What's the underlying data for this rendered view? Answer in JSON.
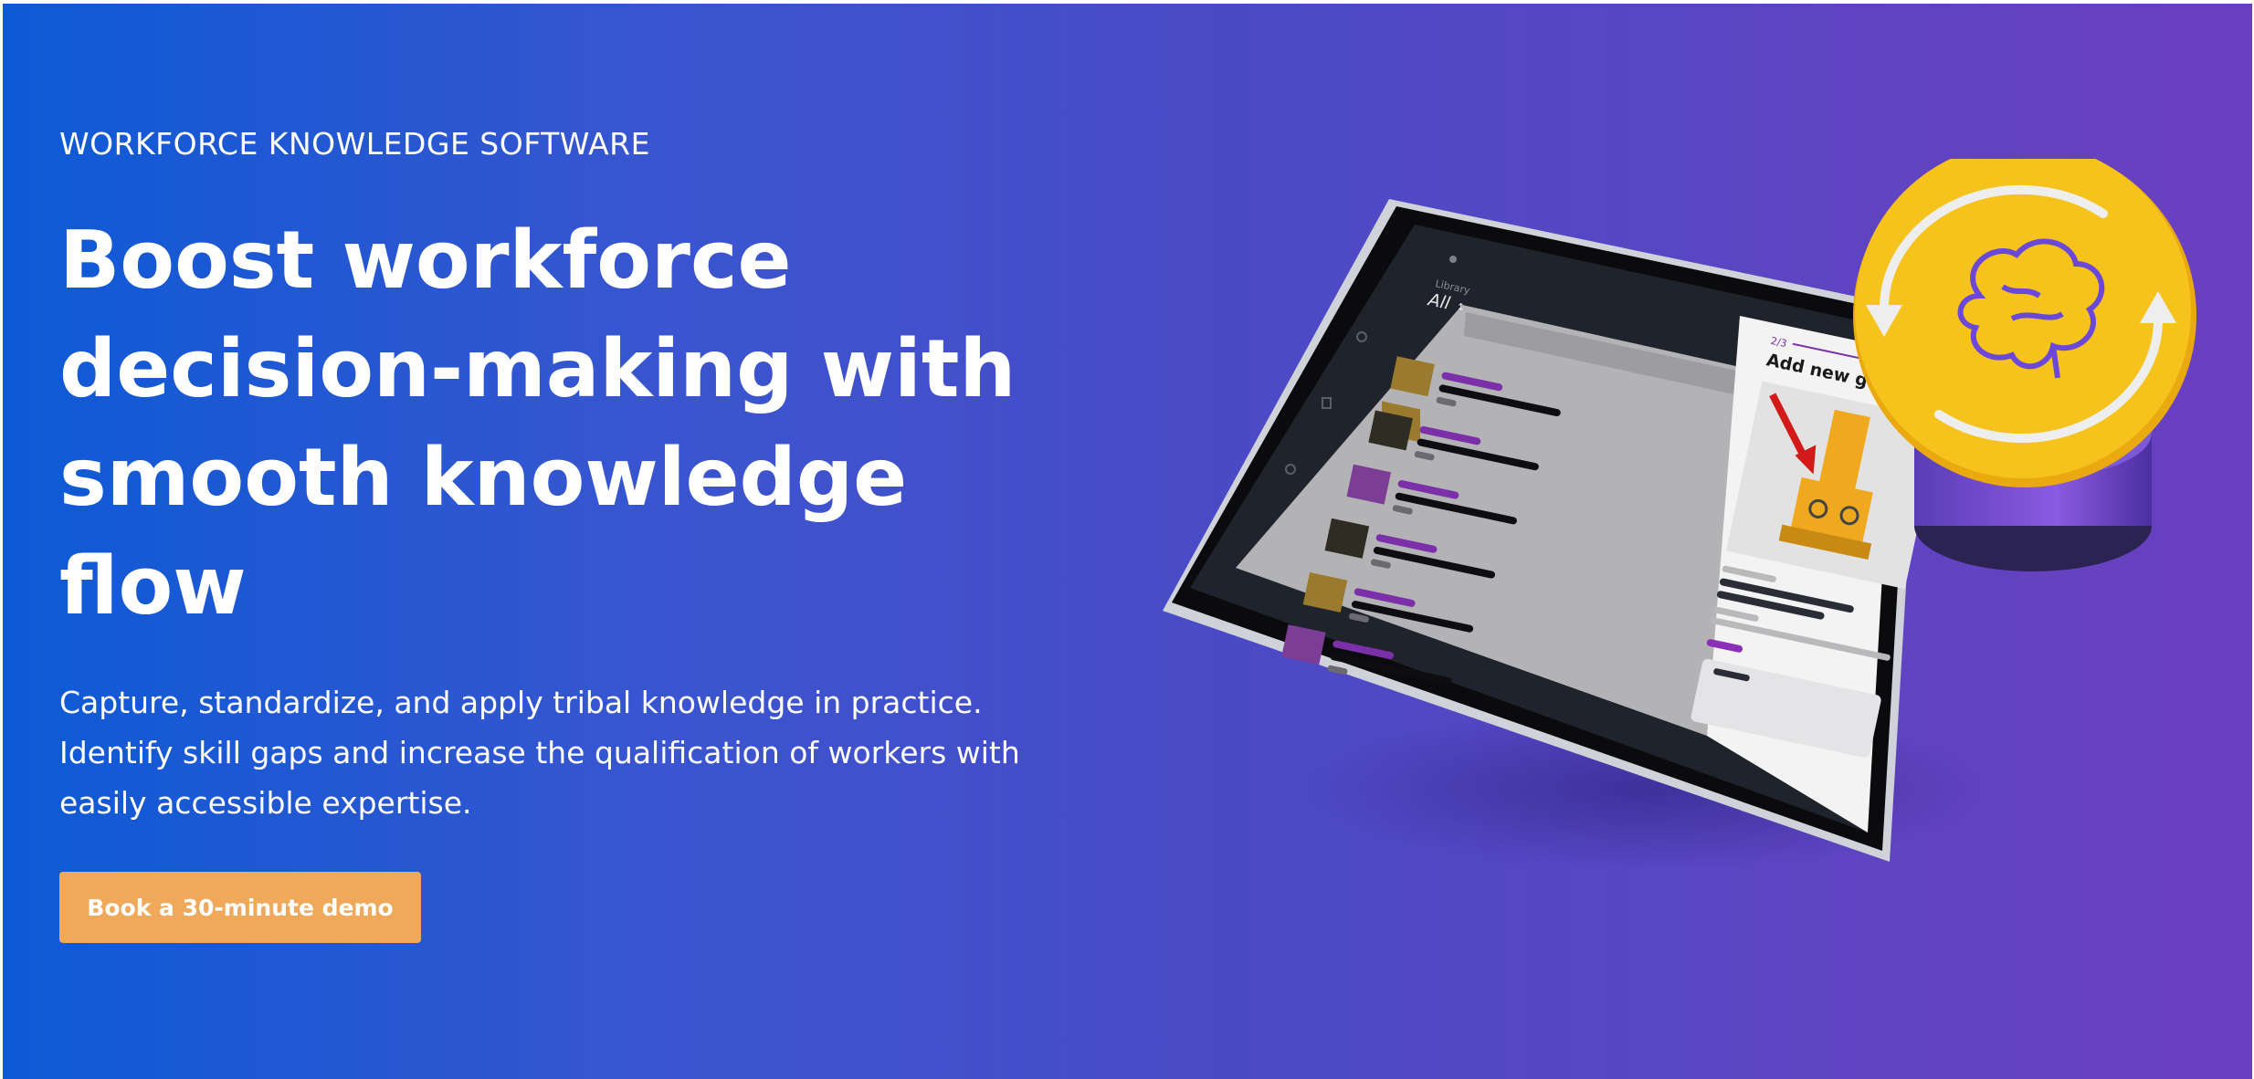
{
  "hero": {
    "eyebrow": "WORKFORCE KNOWLEDGE SOFTWARE",
    "headline": "Boost workforce decision-making with smooth knowledge flow",
    "subtext": "Capture, standardize, and apply tribal knowledge in practice. Identify skill gaps and increase the qualification of workers with easily accessible expertise.",
    "cta_label": "Book a 30-minute demo"
  },
  "tablet": {
    "library_label": "Library",
    "filter_value": "All",
    "step_counter": "2/3",
    "panel_title": "Add new guide"
  },
  "badge": {
    "icon": "brain-refresh-icon"
  },
  "colors": {
    "gradient_start": "#0d5ad6",
    "gradient_end": "#6a3fbf",
    "cta": "#f0a95a",
    "accent_purple": "#7a35a8",
    "badge_yellow": "#f6c21c"
  }
}
